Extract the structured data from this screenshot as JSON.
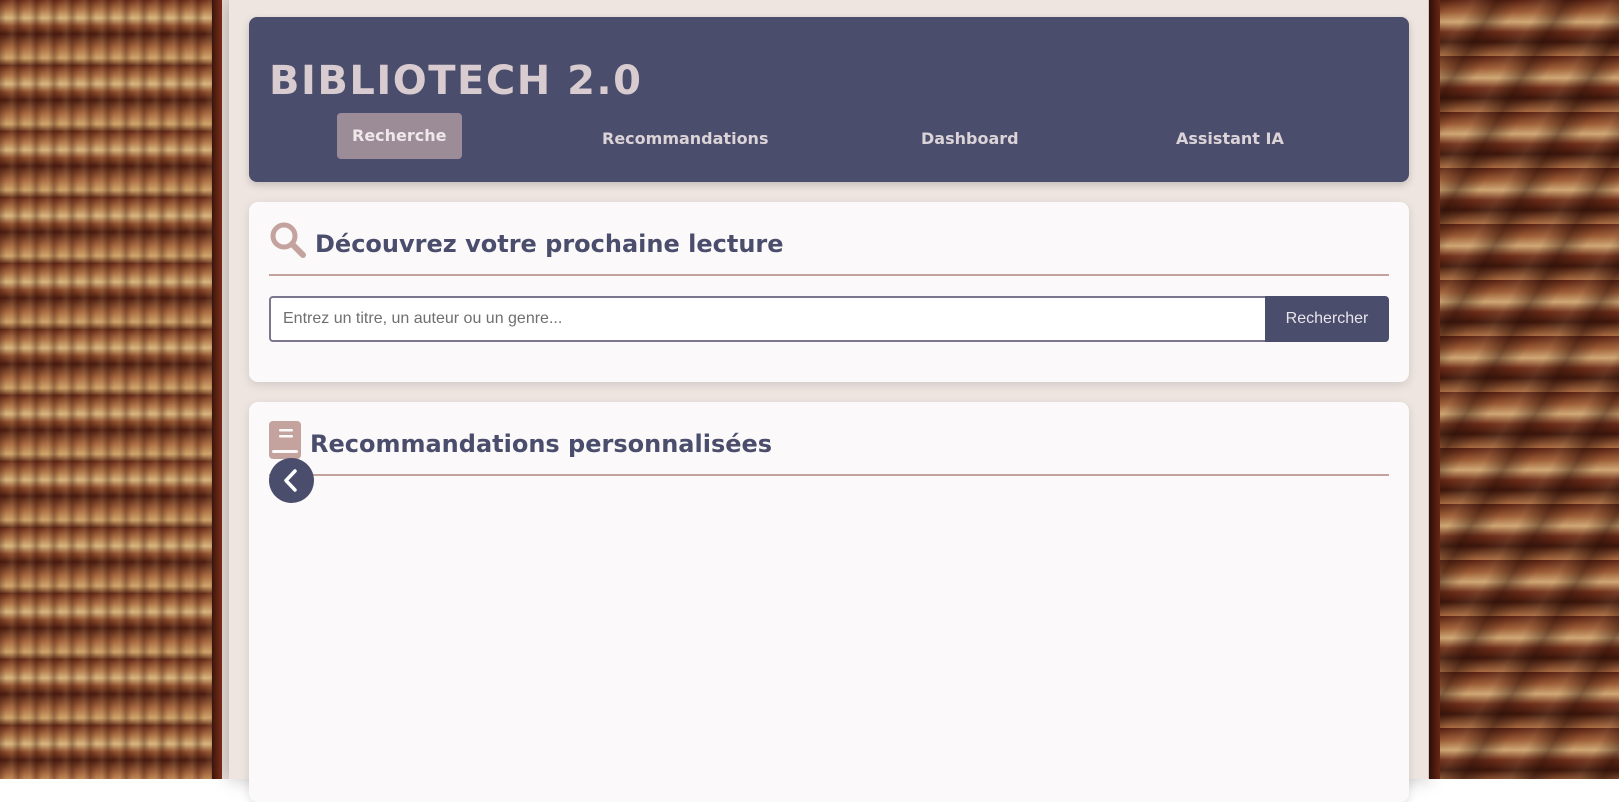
{
  "app": {
    "title": "BIBLIOTECH 2.0"
  },
  "nav": {
    "items": [
      {
        "label": "Recherche",
        "active": true
      },
      {
        "label": "Recommandations",
        "active": false
      },
      {
        "label": "Dashboard",
        "active": false
      },
      {
        "label": "Assistant IA",
        "active": false
      }
    ]
  },
  "search_section": {
    "title": "Découvrez votre prochaine lecture",
    "icon": "search-icon",
    "input": {
      "value": "",
      "placeholder": "Entrez un titre, un auteur ou un genre..."
    },
    "button_label": "Rechercher"
  },
  "reco_section": {
    "title": "Recommandations personnalisées",
    "icon": "book-icon",
    "prev_icon": "chevron-left-icon"
  },
  "colors": {
    "header_bg": "#4a4d6b",
    "active_tab_bg": "#9c8c98",
    "accent_icon": "#c4a39f",
    "title_text": "#4a4d6b",
    "card_bg": "#fbf9f9"
  }
}
